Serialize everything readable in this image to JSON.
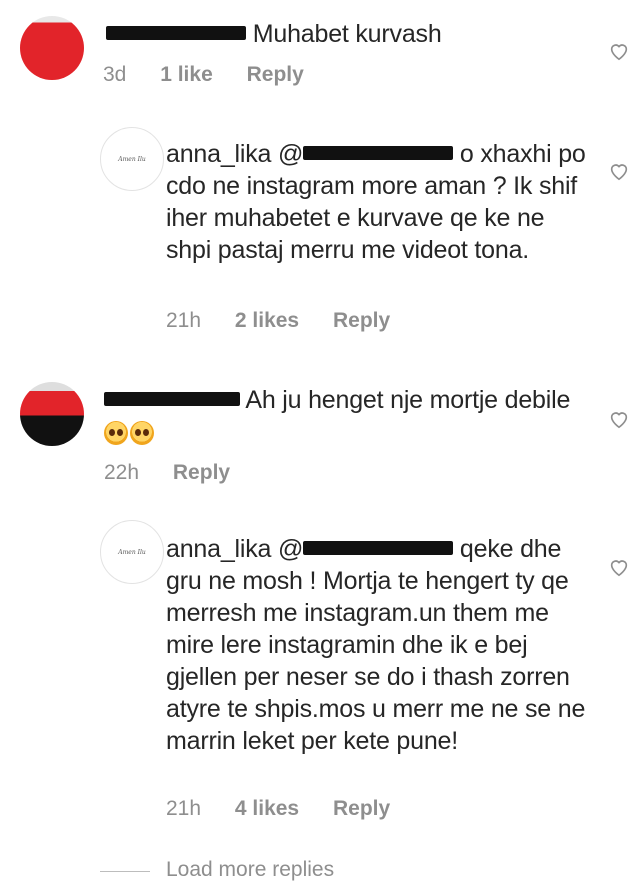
{
  "comments": [
    {
      "user": "",
      "text": "Muhabet kurvash",
      "time": "3d",
      "likes": "1 like",
      "reply": "Reply"
    },
    {
      "user": "anna_lika",
      "mention": "@",
      "text_after_mention": "o xhaxhi",
      "text": "po cdo ne instagram more aman ? Ik shif iher muhabetet e kurvave qe ke ne shpi pastaj merru me videot tona.",
      "time": "21h",
      "likes": "2 likes",
      "reply": "Reply"
    },
    {
      "user": "",
      "text": "Ah ju henget nje mortje debile",
      "time": "22h",
      "likes": "",
      "reply": "Reply"
    },
    {
      "user": "anna_lika",
      "mention": "@",
      "text_after_mention": "qeke dhe",
      "text": "gru ne mosh ! Mortja te hengert ty qe merresh me instagram.un them me mire lere instagramin dhe ik e bej gjellen per neser se do i thash zorren atyre te shpis.mos u merr me ne se ne marrin leket per kete pune!",
      "time": "21h",
      "likes": "4 likes",
      "reply": "Reply"
    }
  ],
  "brand_avatar_text": "Amen Ilu",
  "load_more": "Load more replies",
  "icons": {
    "heart": "heart-outline-icon",
    "emoji": "astonished-face-emoji"
  },
  "colors": {
    "text": "#262626",
    "meta": "#8e8e8e",
    "avatar_red": "#e2242a"
  }
}
